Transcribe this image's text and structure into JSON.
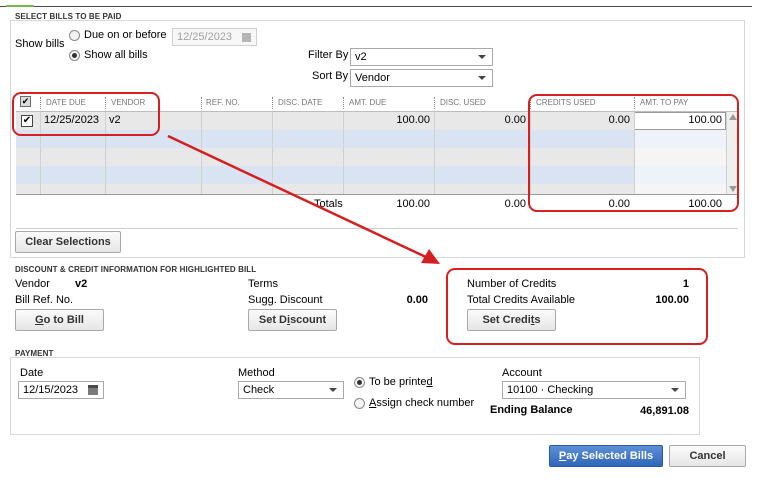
{
  "select_bills": {
    "title": "SELECT BILLS TO BE PAID",
    "show_bills_label": "Show bills",
    "due_on_or_before_label": "Due on or before",
    "due_date_value": "12/25/2023",
    "show_all_label": "Show all bills",
    "filter_by_label": "Filter By",
    "filter_by_value": "v2",
    "sort_by_label": "Sort By",
    "sort_by_value": "Vendor"
  },
  "table": {
    "headers": [
      "DATE DUE",
      "VENDOR",
      "REF. NO.",
      "DISC. DATE",
      "AMT. DUE",
      "DISC. USED",
      "CREDITS USED",
      "AMT. TO PAY"
    ],
    "rows": [
      {
        "date_due": "12/25/2023",
        "vendor": "v2",
        "ref_no": "",
        "disc_date": "",
        "amt_due": "100.00",
        "disc_used": "0.00",
        "credits_used": "0.00",
        "amt_to_pay": "100.00"
      }
    ],
    "totals_label": "Totals",
    "totals": {
      "amt_due": "100.00",
      "disc_used": "0.00",
      "credits_used": "0.00",
      "amt_to_pay": "100.00"
    },
    "clear_selections_label": "Clear Selections"
  },
  "discount_credit": {
    "title": "DISCOUNT & CREDIT INFORMATION FOR HIGHLIGHTED BILL",
    "vendor_label": "Vendor",
    "vendor_value": "v2",
    "bill_ref_label": "Bill Ref. No.",
    "terms_label": "Terms",
    "sugg_discount_label": "Sugg. Discount",
    "sugg_discount_value": "0.00",
    "number_of_credits_label": "Number of Credits",
    "number_of_credits_value": "1",
    "total_credits_label": "Total Credits Available",
    "total_credits_value": "100.00",
    "go_to_bill_pre": "",
    "go_to_bill_u": "G",
    "go_to_bill_post": "o to Bill",
    "set_discount_pre": "Set D",
    "set_discount_u": "i",
    "set_discount_post": "scount",
    "set_credits_pre": "Set Credi",
    "set_credits_u": "t",
    "set_credits_post": "s"
  },
  "payment": {
    "title": "PAYMENT",
    "date_label": "Date",
    "date_value": "12/15/2023",
    "method_label": "Method",
    "method_value": "Check",
    "to_be_printed_pre": "To be printe",
    "to_be_printed_u": "d",
    "assign_check_u": "A",
    "assign_check_post": "ssign check number",
    "account_label": "Account",
    "account_value": "10100 · Checking",
    "ending_balance_label": "Ending Balance",
    "ending_balance_value": "46,891.08"
  },
  "footer": {
    "pay_pre": "",
    "pay_u": "P",
    "pay_post": "ay Selected Bills",
    "cancel_label": "Cancel"
  },
  "colors": {
    "annotation_red": "#d42020",
    "row_blue": "#d9e3f2",
    "row_gray": "#e8e8e8",
    "primary_button": "#2f66b8"
  }
}
